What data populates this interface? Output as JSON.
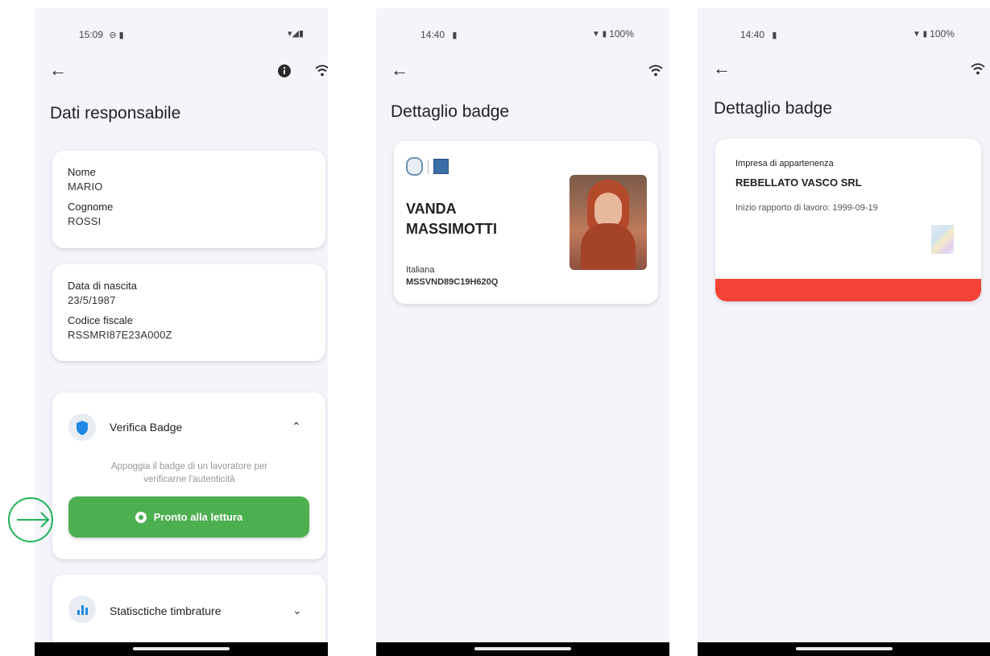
{
  "screen1": {
    "status": {
      "time": "15:09"
    },
    "title": "Dati responsabile",
    "card_name": {
      "nome_label": "Nome",
      "nome_value": "MARIO",
      "cognome_label": "Cognome",
      "cognome_value": "ROSSI"
    },
    "card_birth": {
      "nascita_label": "Data di nascita",
      "nascita_value": "23/5/1987",
      "cf_label": "Codice fiscale",
      "cf_value": "RSSMRI87E23A000Z"
    },
    "verify": {
      "title": "Verifica Badge",
      "description": "Appoggia il badge di un lavoratore per verificarne l'autenticità",
      "button_label": "Pronto alla lettura"
    },
    "stats": {
      "title": "Statisctiche timbrature"
    }
  },
  "screen2": {
    "status": {
      "time": "14:40",
      "battery": "100%"
    },
    "title": "Dettaglio badge",
    "badge": {
      "first_name": "VANDA",
      "last_name": "MASSIMOTTI",
      "nationality": "Italiana",
      "fiscal_code": "MSSVND89C19H620Q"
    }
  },
  "screen3": {
    "status": {
      "time": "14:40",
      "battery": "100%"
    },
    "title": "Dettaglio badge",
    "company": {
      "label": "Impresa di appartenenza",
      "name": "REBELLATO VASCO SRL",
      "start": "Inizio rapporto di lavoro: 1999-09-19"
    }
  },
  "colors": {
    "accent_green": "#4caf50",
    "shield_blue": "#1e88e5",
    "red_bar": "#f44336",
    "arrow_green": "#21b356"
  }
}
